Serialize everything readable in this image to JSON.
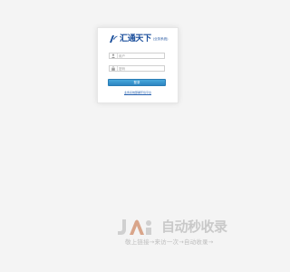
{
  "login": {
    "logo_text": "汇通天下",
    "logo_subtitle": "(业务系统)",
    "username_placeholder": "用户",
    "password_placeholder": "密码",
    "login_button": "登录",
    "help_link": "业务系统部署环境平台"
  },
  "watermark": {
    "brand": "自动秒收录",
    "slogan": "敬上链接→来访一次→自动收录→"
  },
  "colors": {
    "page_background": "#f4f4f4",
    "brand_blue": "#1b4f9c",
    "button_blue": "#3a97d0",
    "watermark_gray": "#c9c9c9"
  },
  "icons": {
    "logo_mark": "brand-logo-icon",
    "username_field": "user-icon",
    "password_field": "lock-icon",
    "watermark_logo": "watermark-logo-icon"
  }
}
